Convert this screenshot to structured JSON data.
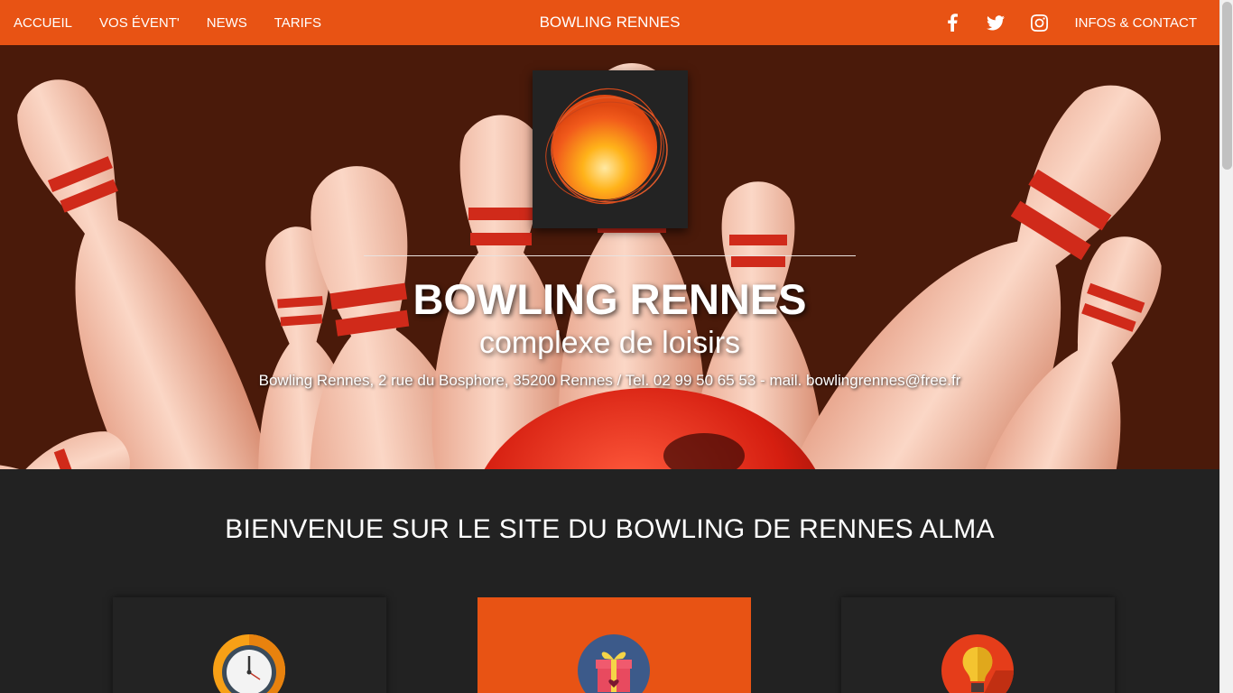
{
  "nav": {
    "left_links": [
      "ACCUEIL",
      "VOS ÉVENT'",
      "NEWS",
      "TARIFS"
    ],
    "brand": "BOWLING RENNES",
    "social_icons": [
      "facebook-icon",
      "twitter-icon",
      "instagram-icon"
    ],
    "right_link": "INFOS & CONTACT",
    "bg_color": "#e85314"
  },
  "hero": {
    "title": "BOWLING RENNES",
    "subtitle": "complexe de loisirs",
    "info": "Bowling Rennes, 2 rue du Bosphore, 35200 Rennes / Tel. 02 99 50 65 53 - mail. bowlingrennes@free.fr"
  },
  "welcome": {
    "title": "BIENVENUE SUR LE SITE DU BOWLING DE RENNES ALMA",
    "cards": [
      {
        "icon": "clock-icon",
        "highlight": false
      },
      {
        "icon": "gift-icon",
        "highlight": true
      },
      {
        "icon": "lightbulb-icon",
        "highlight": false
      }
    ]
  },
  "colors": {
    "accent": "#e85314",
    "dark": "#222222",
    "pin_red": "#d02a1a"
  }
}
